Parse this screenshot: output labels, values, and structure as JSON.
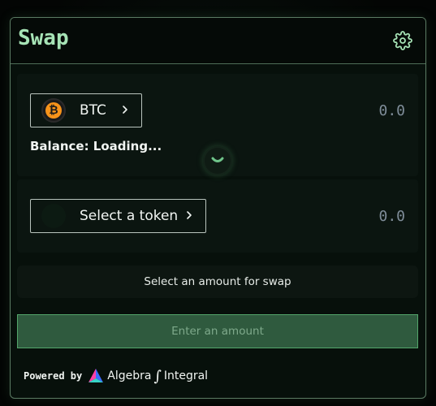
{
  "header": {
    "title": "Swap",
    "settings_icon": "gear-icon"
  },
  "from": {
    "token_symbol": "BTC",
    "token_icon": "bitcoin-icon",
    "amount": "0.0",
    "balance": "Balance: Loading..."
  },
  "to": {
    "token_label": "Select a token",
    "amount": "0.0"
  },
  "swap_toggle_icon": "chevron-down-icon",
  "info": {
    "message": "Select an amount for swap"
  },
  "action": {
    "label": "Enter an amount"
  },
  "footer": {
    "powered_by": "Powered by",
    "brand": "Algebra",
    "integral_symbol": "∫",
    "product": "Integral"
  },
  "colors": {
    "title": "#a6e3b5",
    "accent": "#53a56a",
    "button_bg": "#2f5a3e",
    "amount": "#7f8d99"
  }
}
